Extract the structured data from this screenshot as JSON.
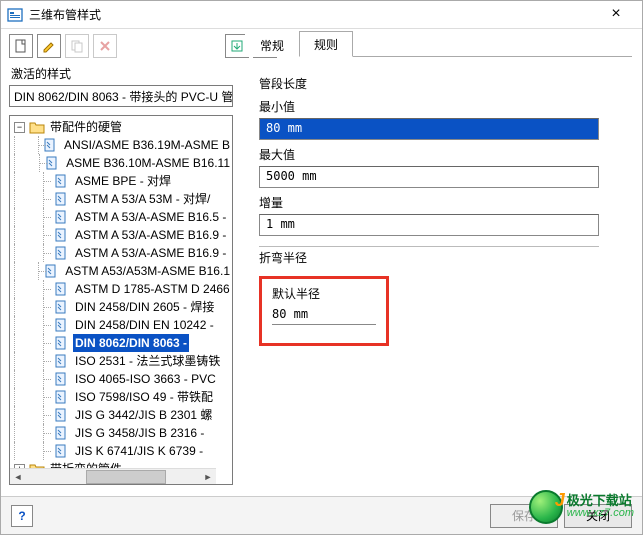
{
  "window": {
    "title": "三维布管样式",
    "close": "×"
  },
  "toolbar": {
    "icons": [
      "new",
      "edit",
      "copy",
      "delete",
      "import",
      "export"
    ]
  },
  "left": {
    "label": "激活的样式",
    "combo_value": "DIN 8062/DIN 8063 - 带接头的 PVC-U 管",
    "root": {
      "label": "带配件的硬管",
      "children": [
        "ANSI/ASME B36.19M-ASME B",
        "ASME B36.10M-ASME B16.11",
        "ASME BPE - 对焊",
        "ASTM A 53/A 53M - 对焊/",
        "ASTM A 53/A-ASME B16.5 -",
        "ASTM A 53/A-ASME B16.9 -",
        "ASTM A 53/A-ASME B16.9 -",
        "ASTM A53/A53M-ASME B16.1",
        "ASTM D 1785-ASTM D 2466 ",
        "DIN 2458/DIN 2605 - 焊接",
        "DIN 2458/DIN EN 10242 - ",
        "DIN 8062/DIN 8063 - ",
        "ISO 2531 - 法兰式球墨铸铁",
        "ISO 4065-ISO 3663 - PVC",
        "ISO 7598/ISO 49 - 带铁配",
        "JIS G 3442/JIS B 2301 螺",
        "JIS G 3458/JIS B 2316 - ",
        "JIS K 6741/JIS K 6739 - "
      ],
      "selected_index": 11
    },
    "root2": {
      "label": "带折弯的管件"
    }
  },
  "tabs": {
    "general": "常规",
    "rules": "规则",
    "active": "rules"
  },
  "panel": {
    "seg_len": "管段长度",
    "min_label": "最小值",
    "min_value": "80 mm",
    "max_label": "最大值",
    "max_value": "5000 mm",
    "inc_label": "增量",
    "inc_value": "1 mm",
    "bend_section": "折弯半径",
    "def_radius_label": "默认半径",
    "def_radius_value": "80 mm"
  },
  "footer": {
    "help": "?",
    "save": "保存",
    "close": "关闭"
  },
  "watermark": {
    "cn": "极光下载站",
    "url": "www.xz7.com"
  }
}
